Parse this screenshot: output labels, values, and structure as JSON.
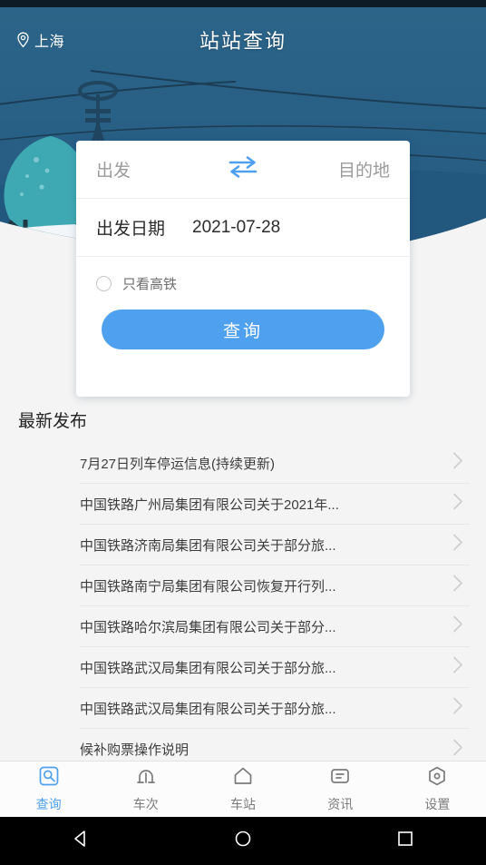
{
  "header": {
    "location": "上海",
    "title": "站站查询",
    "location_icon": "map-pin-icon"
  },
  "search_card": {
    "from_placeholder": "出发",
    "to_placeholder": "目的地",
    "swap_icon": "swap-horizontal-icon",
    "date_label": "出发日期",
    "date_value": "2021-07-28",
    "option_label": "只看高铁",
    "option_checked": false,
    "submit_label": "查询"
  },
  "news": {
    "title": "最新发布",
    "items": [
      {
        "text": "7月27日列车停运信息(持续更新)"
      },
      {
        "text": "中国铁路广州局集团有限公司关于2021年..."
      },
      {
        "text": "中国铁路济南局集团有限公司关于部分旅..."
      },
      {
        "text": "中国铁路南宁局集团有限公司恢复开行列..."
      },
      {
        "text": "中国铁路哈尔滨局集团有限公司关于部分..."
      },
      {
        "text": "中国铁路武汉局集团有限公司关于部分旅..."
      },
      {
        "text": "中国铁路武汉局集团有限公司关于部分旅..."
      },
      {
        "text": "候补购票操作说明"
      }
    ],
    "chevron_icon": "chevron-right-icon"
  },
  "tabbar": {
    "tabs": [
      {
        "label": "查询",
        "icon": "search-square-icon",
        "active": true
      },
      {
        "label": "车次",
        "icon": "train-arch-icon",
        "active": false
      },
      {
        "label": "车站",
        "icon": "home-icon",
        "active": false
      },
      {
        "label": "资讯",
        "icon": "document-lines-icon",
        "active": false
      },
      {
        "label": "设置",
        "icon": "gear-hexagon-icon",
        "active": false
      }
    ]
  },
  "androidnav": {
    "back_icon": "triangle-back-icon",
    "home_icon": "circle-home-icon",
    "recents_icon": "square-recents-icon"
  },
  "colors": {
    "banner_blue": "#2a6087",
    "accent_blue": "#4fa1f0",
    "page_bg": "#f4f4f4",
    "card_bg": "#ffffff"
  }
}
